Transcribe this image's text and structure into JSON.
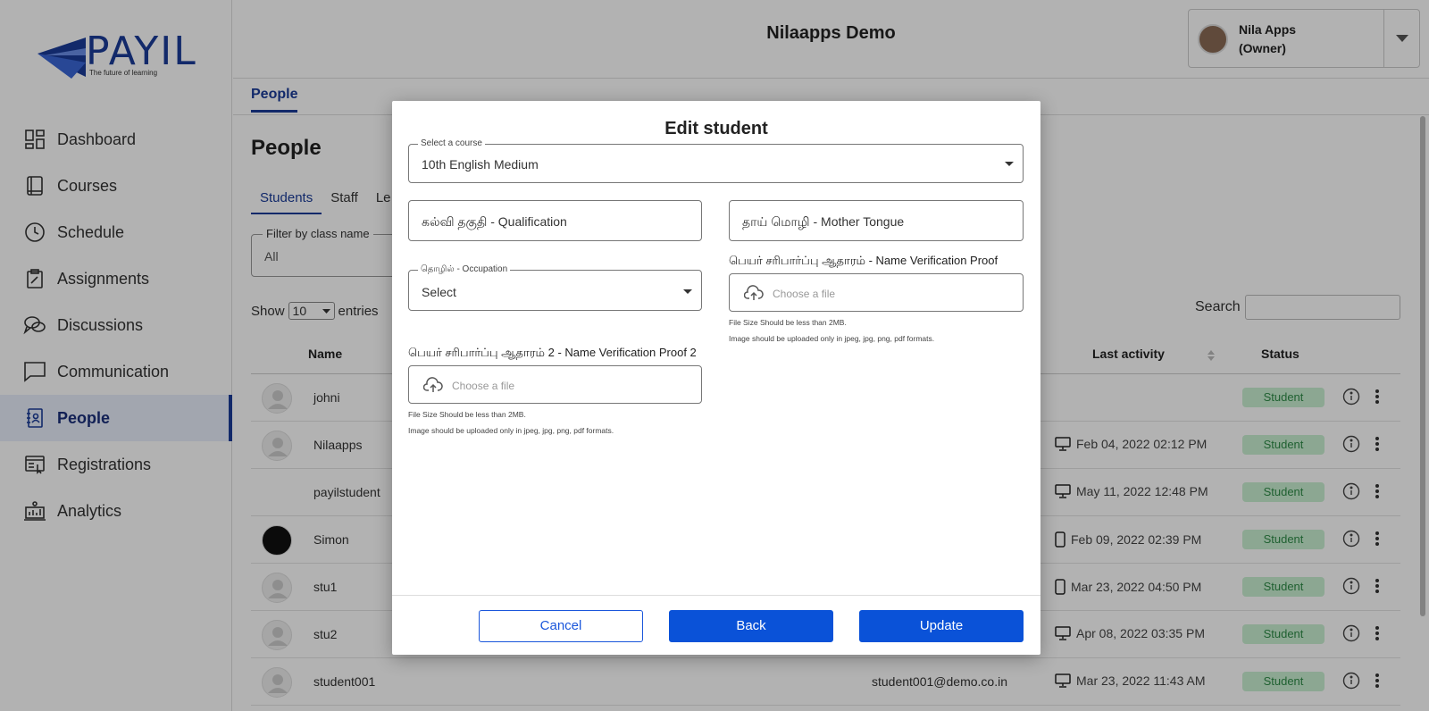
{
  "brand": {
    "name": "PAYIL",
    "tagline": "The future of learning"
  },
  "sidebar": {
    "items": [
      {
        "label": "Dashboard",
        "icon": "dashboard-icon"
      },
      {
        "label": "Courses",
        "icon": "book-icon"
      },
      {
        "label": "Schedule",
        "icon": "clock-icon"
      },
      {
        "label": "Assignments",
        "icon": "clipboard-icon"
      },
      {
        "label": "Discussions",
        "icon": "chat-bubbles-icon"
      },
      {
        "label": "Communication",
        "icon": "message-icon"
      },
      {
        "label": "People",
        "icon": "people-book-icon",
        "active": true
      },
      {
        "label": "Registrations",
        "icon": "registration-icon"
      },
      {
        "label": "Analytics",
        "icon": "analytics-icon"
      }
    ]
  },
  "header": {
    "title": "Nilaapps Demo",
    "user_name": "Nila Apps",
    "user_role": "(Owner)"
  },
  "subnav": {
    "tab": "People"
  },
  "main": {
    "title": "People",
    "tabs": [
      "Students",
      "Staff",
      "Le"
    ],
    "filter_label": "Filter by class name",
    "filter_value": "All",
    "show_label": "Show",
    "show_value": "10",
    "entries_label": "entries",
    "search_label": "Search",
    "columns": {
      "name": "Name",
      "last_activity": "Last activity",
      "status": "Status"
    },
    "rows": [
      {
        "name": "johni",
        "email": "",
        "activity": "",
        "device": "",
        "status": "Student"
      },
      {
        "name": "Nilaapps",
        "email": "",
        "activity": "Feb 04, 2022 02:12 PM",
        "device": "desktop",
        "status": "Student"
      },
      {
        "name": "payilstudent",
        "email": "",
        "activity": "May 11, 2022 12:48 PM",
        "device": "desktop",
        "status": "Student"
      },
      {
        "name": "Simon",
        "email": "",
        "activity": "Feb 09, 2022 02:39 PM",
        "device": "mobile",
        "status": "Student"
      },
      {
        "name": "stu1",
        "email": "",
        "activity": "Mar 23, 2022 04:50 PM",
        "device": "mobile",
        "status": "Student"
      },
      {
        "name": "stu2",
        "email": "",
        "activity": "Apr 08, 2022 03:35 PM",
        "device": "desktop",
        "status": "Student"
      },
      {
        "name": "student001",
        "email": "student001@demo.co.in",
        "activity": "Mar 23, 2022 11:43 AM",
        "device": "desktop",
        "status": "Student"
      }
    ]
  },
  "modal": {
    "title": "Edit student",
    "course": {
      "label": "Select a course",
      "value": "10th English Medium"
    },
    "qualification": {
      "value": "கல்வி தகுதி - Qualification"
    },
    "mother_tongue": {
      "value": "தாய் மொழி - Mother Tongue"
    },
    "occupation": {
      "label": "தொழில் - Occupation",
      "value": "Select"
    },
    "proof1": {
      "label": "பெயர் சரிபார்ப்பு ஆதாரம் - Name Verification Proof",
      "placeholder": "Choose a file"
    },
    "proof2": {
      "label": "பெயர் சரிபார்ப்பு ஆதாரம் 2 - Name Verification Proof 2",
      "placeholder": "Choose a file"
    },
    "hint_size": "File Size Should be less than 2MB.",
    "hint_format": "Image should be uploaded only in jpeg, jpg, png, pdf formats.",
    "buttons": {
      "cancel": "Cancel",
      "back": "Back",
      "update": "Update"
    },
    "colors": {
      "primary": "#0a52d8"
    }
  }
}
